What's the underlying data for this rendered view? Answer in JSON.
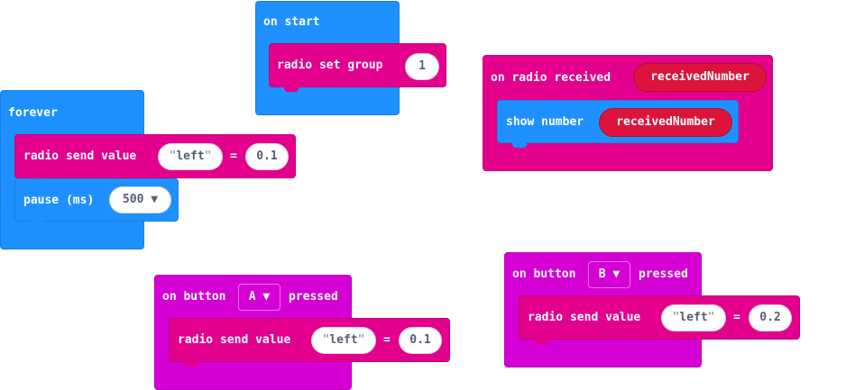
{
  "on_start": {
    "label": "on start",
    "radio_set_group": {
      "label": "radio set group",
      "value": "1"
    }
  },
  "forever": {
    "label": "forever",
    "send": {
      "label": "radio send value",
      "name": "left",
      "equals": "=",
      "value": "0.1"
    },
    "pause": {
      "label": "pause (ms)",
      "value": "500"
    }
  },
  "on_radio_received": {
    "label": "on radio received",
    "param": "receivedNumber",
    "show_number": {
      "label": "show number",
      "value": "receivedNumber"
    }
  },
  "on_button_a": {
    "label_pre": "on button",
    "button": "A",
    "label_post": "pressed",
    "send": {
      "label": "radio send value",
      "name": "left",
      "equals": "=",
      "value": "0.1"
    }
  },
  "on_button_b": {
    "label_pre": "on button",
    "button": "B",
    "label_post": "pressed",
    "send": {
      "label": "radio send value",
      "name": "left",
      "equals": "=",
      "value": "0.2"
    }
  },
  "dropdown_arrow": "▼",
  "quote_open": "\"",
  "quote_close": "\"",
  "colors": {
    "basic": "#1e90ff",
    "radio": "#e3008c",
    "input": "#d400d4",
    "variable": "#dc143c"
  }
}
